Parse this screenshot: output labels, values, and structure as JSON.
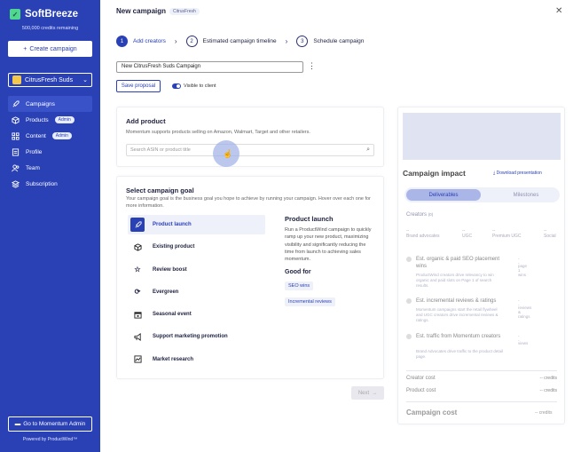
{
  "sidebar": {
    "brand": "SoftBreeze",
    "credits": "500,000 credits remaining",
    "create_campaign": "Create campaign",
    "selected_brand": "CitrusFresh Suds",
    "nav": [
      {
        "label": "Campaigns",
        "icon": "rocket-icon",
        "active": true
      },
      {
        "label": "Products",
        "icon": "box-icon",
        "badge": "Admin"
      },
      {
        "label": "Content",
        "icon": "grid-icon",
        "badge": "Admin"
      },
      {
        "label": "Profile",
        "icon": "profile-icon"
      },
      {
        "label": "Team",
        "icon": "team-icon"
      },
      {
        "label": "Subscription",
        "icon": "stack-icon"
      }
    ],
    "go_admin": "Go to Momentum Admin",
    "powered_by": "Powered by ProductWind™"
  },
  "header": {
    "title": "New campaign",
    "tag": "CitrusFresh"
  },
  "steps": [
    {
      "num": "1",
      "label": "Add creators"
    },
    {
      "num": "2",
      "label": "Estimated campaign timeline"
    },
    {
      "num": "3",
      "label": "Schedule campaign"
    }
  ],
  "campaign_name": "New CitrusFresh Suds Campaign",
  "save_proposal": "Save proposal",
  "visible_to_client": "Visible to client",
  "add_product": {
    "title": "Add product",
    "subtitle": "Momentum supports products selling on Amazon, Walmart, Target and other retailers.",
    "search_placeholder": "Search ASIN or product title"
  },
  "goal": {
    "title": "Select campaign goal",
    "subtitle": "Your campaign goal is the business goal you hope to achieve by running your campaign. Hover over each one for more information.",
    "items": [
      {
        "label": "Product launch",
        "icon": "rocket-icon"
      },
      {
        "label": "Existing product",
        "icon": "box-icon"
      },
      {
        "label": "Review boost",
        "icon": "star-icon"
      },
      {
        "label": "Evergreen",
        "icon": "refresh-icon"
      },
      {
        "label": "Seasonal event",
        "icon": "calendar-icon"
      },
      {
        "label": "Support marketing promotion",
        "icon": "megaphone-icon"
      },
      {
        "label": "Market research",
        "icon": "chart-icon"
      }
    ],
    "detail_title": "Product launch",
    "detail_text": "Run a ProductWind campaign to quickly ramp up your new product, maximizing visibility and significantly reducing the time from launch to achieving sales momentum.",
    "good_for": "Good for",
    "tags": [
      "SEO wins",
      "Incremental reviews"
    ]
  },
  "next": "Next",
  "impact": {
    "title": "Campaign impact",
    "download": "Download presentation",
    "tab_active": "Deliverables",
    "tab_inactive": "Milestones",
    "creators_label": "Creators",
    "creators_count": "(0)",
    "stats": [
      {
        "val": "--",
        "label": "Brand advocates"
      },
      {
        "val": "--",
        "label": "UGC"
      },
      {
        "val": "--",
        "label": "Premium UGC"
      },
      {
        "val": "--",
        "label": "Social"
      }
    ],
    "rows": [
      {
        "title": "Est. organic & paid SEO placement wins",
        "desc": "ProductWind creators drive relevancy to win organic and paid slots on Page 1 of search results.",
        "val": "--",
        "unit": "page 1 wins"
      },
      {
        "title": "Est. incremental reviews & ratings",
        "desc": "Momentum campaigns start the retail flywheel and UGC creators drive incremental reviews & ratings.",
        "val": "--",
        "unit": "reviews & ratings"
      },
      {
        "title": "Est. traffic from Momentum creators",
        "desc": "Brand Advocates drive traffic to the product detail page.",
        "val": "--",
        "unit": "views"
      }
    ],
    "creator_cost": "Creator cost",
    "creator_cost_val": "-- credits",
    "product_cost": "Product cost",
    "product_cost_val": "-- credits",
    "campaign_cost": "Campaign cost",
    "campaign_cost_val": "-- credits"
  }
}
